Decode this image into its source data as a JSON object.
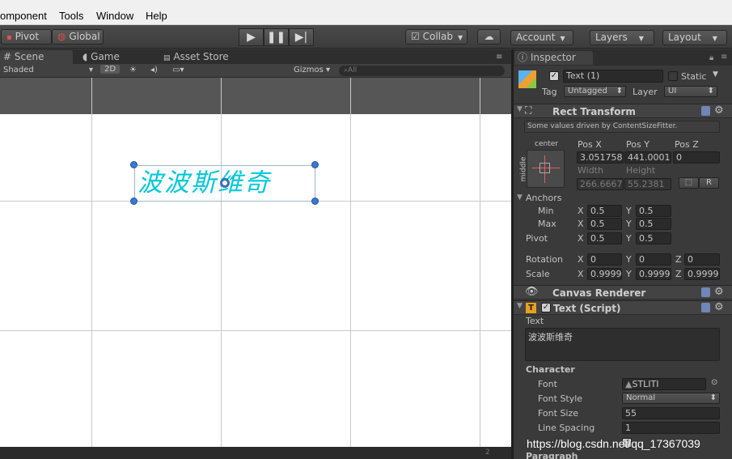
{
  "menu": {
    "component": "omponent",
    "tools": "Tools",
    "window": "Window",
    "help": "Help"
  },
  "toolbar": {
    "pivot": "Pivot",
    "global": "Global",
    "collab": "Collab",
    "account": "Account",
    "layers": "Layers",
    "layout": "Layout"
  },
  "scene": {
    "tabs": [
      {
        "label": "Scene"
      },
      {
        "label": "Game"
      },
      {
        "label": "Asset Store"
      }
    ],
    "shading": "Shaded",
    "mode_2d": "2D",
    "gizmos": "Gizmos",
    "search_placeholder": "All",
    "text_object": "波波斯维奇",
    "status_right": "2"
  },
  "inspector": {
    "tab": "Inspector",
    "object_name": "Text (1)",
    "static_label": "Static",
    "tag_label": "Tag",
    "tag_value": "Untagged",
    "layer_label": "Layer",
    "layer_value": "UI",
    "rect_transform": {
      "title": "Rect Transform",
      "info": "Some values driven by ContentSizeFitter.",
      "anchor_h": "center",
      "anchor_v": "middle",
      "pos_x_label": "Pos X",
      "pos_y_label": "Pos Y",
      "pos_z_label": "Pos Z",
      "pos_x": "3.051758",
      "pos_y": "441.0001",
      "pos_z": "0",
      "width_label": "Width",
      "height_label": "Height",
      "width": "266.6667",
      "height": "55.2381",
      "r_button": "R",
      "anchors_label": "Anchors",
      "min_label": "Min",
      "max_label": "Max",
      "pivot_label": "Pivot",
      "x": "X",
      "y": "Y",
      "z": "Z",
      "min_x": "0.5",
      "min_y": "0.5",
      "max_x": "0.5",
      "max_y": "0.5",
      "pivot_x": "0.5",
      "pivot_y": "0.5",
      "rotation_label": "Rotation",
      "rot_x": "0",
      "rot_y": "0",
      "rot_z": "0",
      "scale_label": "Scale",
      "scale_x": "0.9999",
      "scale_y": "0.9999",
      "scale_z": "0.9999"
    },
    "canvas_renderer": {
      "title": "Canvas Renderer"
    },
    "text_script": {
      "title": "Text (Script)",
      "text_label": "Text",
      "text_value": "波波斯维奇",
      "character_label": "Character",
      "font_label": "Font",
      "font_value": "STLITI",
      "font_style_label": "Font Style",
      "font_style_value": "Normal",
      "font_size_label": "Font Size",
      "font_size_value": "55",
      "line_spacing_label": "Line Spacing",
      "line_spacing_value": "1",
      "paragraph_label": "Paragraph"
    }
  },
  "watermark": "https://blog.csdn.net/qq_17367039",
  "colors": {
    "accent_text": "#00c8d8",
    "handle": "#3a78d6"
  }
}
